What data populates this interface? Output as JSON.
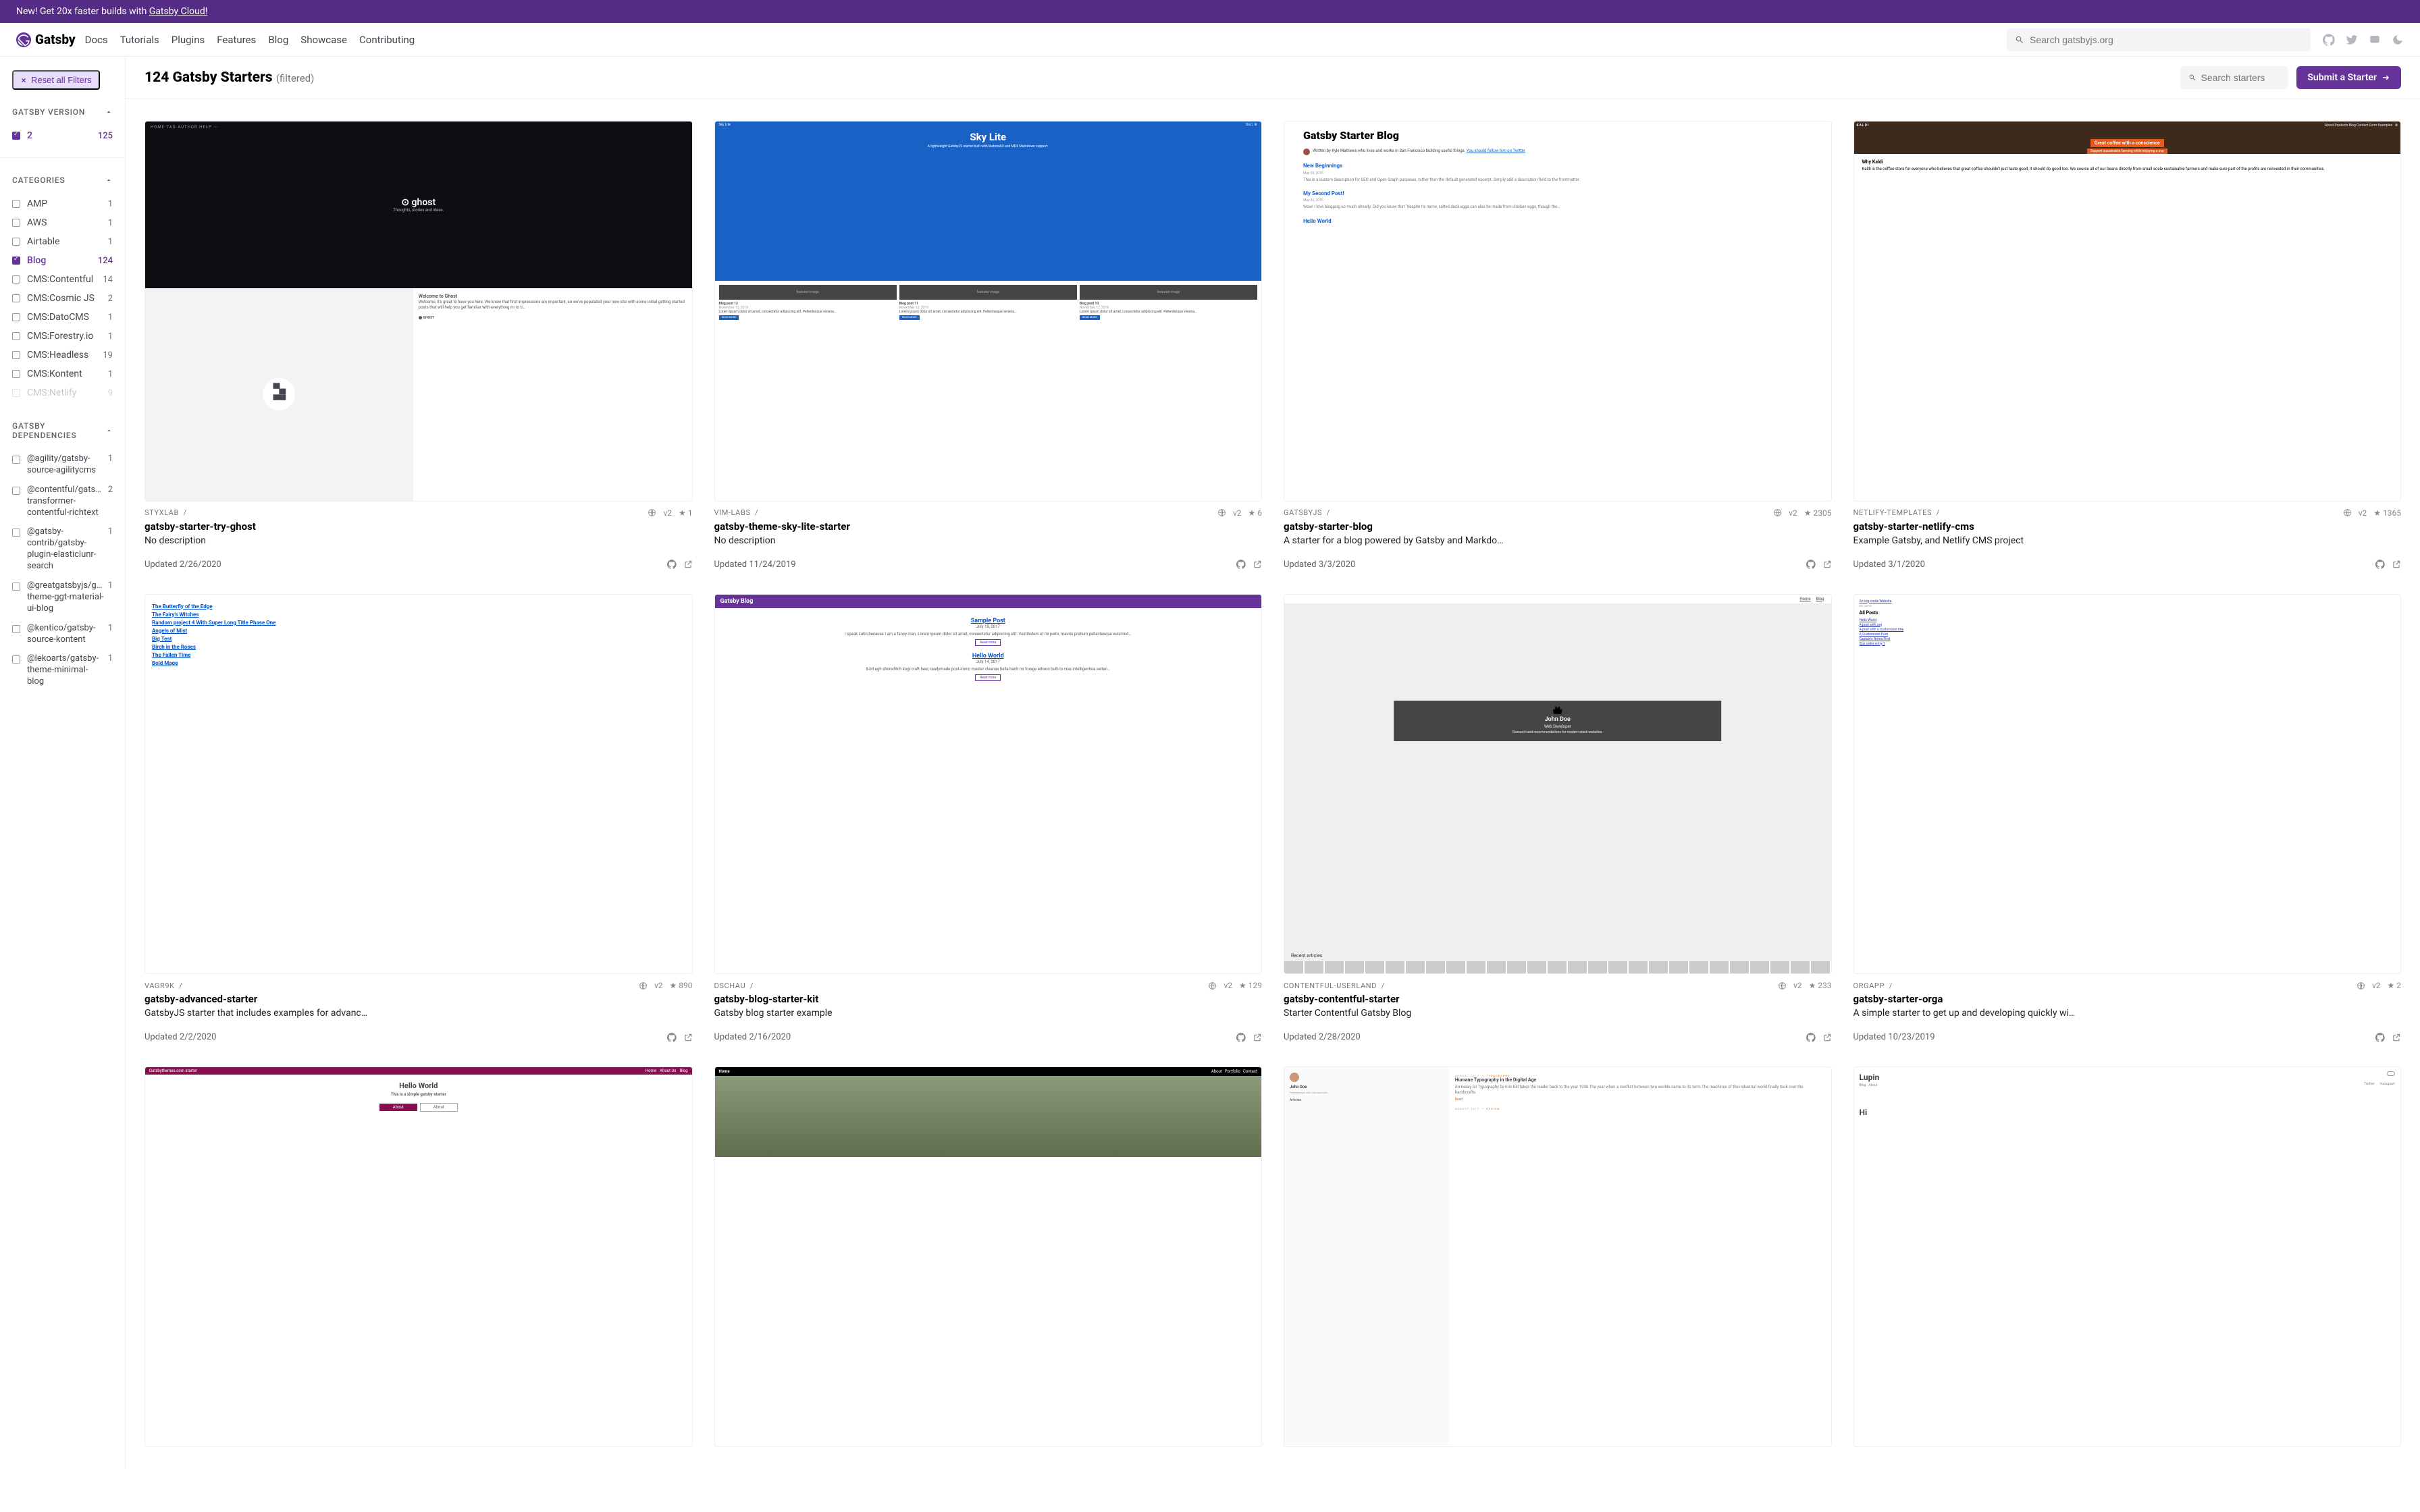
{
  "banner": {
    "text": "New! Get 20x faster builds with ",
    "link_text": "Gatsby Cloud!"
  },
  "brand": "Gatsby",
  "nav": [
    "Docs",
    "Tutorials",
    "Plugins",
    "Features",
    "Blog",
    "Showcase",
    "Contributing"
  ],
  "search_global_placeholder": "Search gatsbyjs.org",
  "reset_label": "Reset all Filters",
  "header": {
    "title": "124 Gatsby Starters",
    "filtered": "(filtered)"
  },
  "search_starters_placeholder": "Search starters",
  "submit_label": "Submit a Starter",
  "filters": {
    "version": {
      "title": "GATSBY VERSION",
      "items": [
        {
          "label": "2",
          "count": "125",
          "checked": true
        }
      ]
    },
    "categories": {
      "title": "CATEGORIES",
      "items": [
        {
          "label": "AMP",
          "count": "1"
        },
        {
          "label": "AWS",
          "count": "1"
        },
        {
          "label": "Airtable",
          "count": "1"
        },
        {
          "label": "Blog",
          "count": "124",
          "checked": true
        },
        {
          "label": "CMS:Contentful",
          "count": "14"
        },
        {
          "label": "CMS:Cosmic JS",
          "count": "2"
        },
        {
          "label": "CMS:DatoCMS",
          "count": "1"
        },
        {
          "label": "CMS:Forestry.io",
          "count": "1"
        },
        {
          "label": "CMS:Headless",
          "count": "19"
        },
        {
          "label": "CMS:Kontent",
          "count": "1"
        },
        {
          "label": "CMS:Netlify",
          "count": "9",
          "faded": true
        }
      ]
    },
    "deps": {
      "title": "GATSBY DEPENDENCIES",
      "items": [
        {
          "label": "@agility/gatsby-source-agilitycms",
          "count": "1"
        },
        {
          "label": "@contentful/gatsby-transformer-contentful-richtext",
          "count": "2"
        },
        {
          "label": "@gatsby-contrib/gatsby-plugin-elasticlunr-search",
          "count": "1"
        },
        {
          "label": "@greatgatsbyjs/gatsby-theme-ggt-material-ui-blog",
          "count": "1"
        },
        {
          "label": "@kentico/gatsby-source-kontent",
          "count": "1"
        },
        {
          "label": "@lekoarts/gatsby-theme-minimal-blog",
          "count": "1"
        }
      ]
    }
  },
  "cards": [
    {
      "author": "STYXLAB",
      "title": "gatsby-starter-try-ghost",
      "desc": "No description",
      "version": "v2",
      "stars": "1",
      "updated": "Updated 2/26/2020",
      "thumb": {
        "type": "t1",
        "logo": "ghost",
        "tagline": "Thoughts, stories and ideas.",
        "nav": "HOME  TAG  AUTHOR  HELP  ⋯",
        "heading": "Welcome to Ghost",
        "body": "Welcome, it's great to have you here. We know that first impressions are important, so we've populated your new site with some initial getting started posts that will help you get familiar with everything in no ti…"
      }
    },
    {
      "author": "VIM-LABS",
      "title": "gatsby-theme-sky-lite-starter",
      "desc": "No description",
      "version": "v2",
      "stars": "6",
      "updated": "Updated 11/24/2019",
      "thumb": {
        "type": "t2",
        "brand": "Sky Lite",
        "tag": "A lightweight GatsbyJS starter built with MaterialUI and MDX Markdown support.",
        "posts": [
          "Blog post 12",
          "Blog post 11",
          "Blog post 10"
        ]
      }
    },
    {
      "author": "GATSBYJS",
      "title": "gatsby-starter-blog",
      "desc": "A starter for a blog powered by Gatsby and Markdo…",
      "version": "v2",
      "stars": "2305",
      "updated": "Updated 3/3/2020",
      "thumb": {
        "type": "t3",
        "h": "Gatsby Starter Blog",
        "by": "Written by Kyle Mathews who lives and works in San Francisco building useful things.",
        "follow": "You should follow him on Twitter",
        "p1": "New Beginnings",
        "p1d": "This is a custom description for SEO and Open Graph purposes, rather than the default generated excerpt. Simply add a description field to the frontmatter.",
        "p2": "My Second Post!",
        "p2d": "Wow! I love blogging so much already. Did you know that \"despite its name, salted duck eggs can also be made from chicken eggs, though the…",
        "p3": "Hello World"
      }
    },
    {
      "author": "NETLIFY-TEMPLATES",
      "title": "gatsby-starter-netlify-cms",
      "desc": "Example Gatsby, and Netlify CMS project",
      "version": "v2",
      "stars": "1365",
      "updated": "Updated 3/1/2020",
      "thumb": {
        "type": "t4",
        "brand": "KALDI",
        "nav": "About  Products  Blog  Contact  Form Examples",
        "b1": "Great coffee with a conscience",
        "b2": "Support sustainable farming while enjoying a cup",
        "h": "Why Kaldi",
        "body": "Kaldi is the coffee store for everyone who believes that great coffee shouldn't just taste good, it should do good too. We source all of our beans directly from small scale sustainable farmers and make sure part of the profits are reinvested in their communities."
      }
    },
    {
      "author": "VAGR9K",
      "title": "gatsby-advanced-starter",
      "desc": "GatsbyJS starter that includes examples for advanc…",
      "version": "v2",
      "stars": "890",
      "updated": "Updated 2/2/2020",
      "thumb": {
        "type": "t5",
        "links": [
          "The Butterfly of the Edge",
          "The Fairy's Witches",
          "Random project 4 With Super Long Title Phase One",
          "Angels of Mist",
          "Big Test",
          "Birch in the Roses",
          "The Fallen Time",
          "Bold Mage"
        ]
      }
    },
    {
      "author": "DSCHAU",
      "title": "gatsby-blog-starter-kit",
      "desc": "Gatsby blog starter example",
      "version": "v2",
      "stars": "129",
      "updated": "Updated 2/16/2020",
      "thumb": {
        "type": "t6",
        "hd": "Gatsby Blog",
        "p1": "Sample Post",
        "d1": "July 18, 2017",
        "p2": "Hello World",
        "d2": "July 14, 2017"
      }
    },
    {
      "author": "CONTENTFUL-USERLAND",
      "title": "gatsby-contentful-starter",
      "desc": "Starter Contentful Gatsby Blog",
      "version": "v2",
      "stars": "233",
      "updated": "Updated 2/28/2020",
      "thumb": {
        "type": "t7",
        "name": "John Doe",
        "role": "Web Developer",
        "tag": "Research and recommendations for modern stack websites.",
        "rec": "Recent articles"
      }
    },
    {
      "author": "ORGAPP",
      "title": "gatsby-starter-orga",
      "desc": "A simple starter to get up and developing quickly wi…",
      "version": "v2",
      "stars": "2",
      "updated": "Updated 10/23/2019",
      "thumb": {
        "type": "t8",
        "site": "An org-mode Website",
        "h": "All Posts",
        "links": [
          "Hello World",
          "A post with org",
          "A post with a customized title",
          "A Customized Post",
          "Captain's Notes.First",
          "Star order entry 1"
        ]
      }
    },
    {
      "author": "",
      "title": "",
      "desc": "",
      "partial": true,
      "thumb": {
        "type": "t9",
        "bar": "Gatsbythemes.com starter",
        "nav": [
          "Home",
          "About Us",
          "Blog"
        ],
        "h": "Hello World",
        "p": "This is a simple gatsby-starter",
        "b1": "About",
        "b2": "About"
      }
    },
    {
      "author": "",
      "title": "",
      "desc": "",
      "partial": true,
      "thumb": {
        "type": "t10",
        "brand": "Home",
        "nav": [
          "About",
          "Portfolio",
          "Contact"
        ]
      }
    },
    {
      "author": "",
      "title": "",
      "desc": "",
      "partial": true,
      "thumb": {
        "type": "t11",
        "name": "John Doe",
        "tag": "AUGUST 2017",
        "h": "Humane Typography in the Digital Age",
        "body": "An Essay on Typography by Eric Gill takes the reader back to the year 1930.The year when a conflict between two worlds came to its term.The machines of the industrial world finally took over the handicrafts.",
        "tag2": "AUGUST 2017"
      }
    },
    {
      "author": "",
      "title": "",
      "desc": "",
      "partial": true,
      "thumb": {
        "type": "t12",
        "brand": "Lupin",
        "tabs": [
          "Twitter",
          "Instagram"
        ],
        "nav": [
          "Blog",
          "About"
        ],
        "h": "Hi"
      }
    }
  ]
}
